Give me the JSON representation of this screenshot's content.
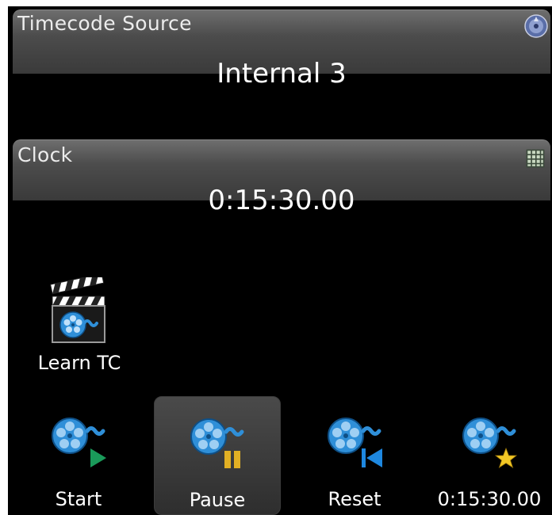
{
  "timecode_source": {
    "label": "Timecode Source",
    "value": "Internal 3",
    "icon": "settings-disc-icon"
  },
  "clock": {
    "label": "Clock",
    "value": "0:15:30.00",
    "icon": "keypad-icon"
  },
  "learn": {
    "label": "Learn TC",
    "icon": "clapperboard-film-reel-icon"
  },
  "controls": [
    {
      "label": "Start",
      "icon": "film-reel-play-icon"
    },
    {
      "label": "Pause",
      "icon": "film-reel-pause-icon",
      "active": true
    },
    {
      "label": "Reset",
      "icon": "film-reel-rewind-icon"
    },
    {
      "label": "0:15:30.00",
      "icon": "film-reel-star-icon"
    }
  ],
  "colors": {
    "reel": "#2f8fd8",
    "play": "#1a9a5a",
    "pause": "#e2b024",
    "rewind": "#1e88e0",
    "star": "#f2c826"
  }
}
